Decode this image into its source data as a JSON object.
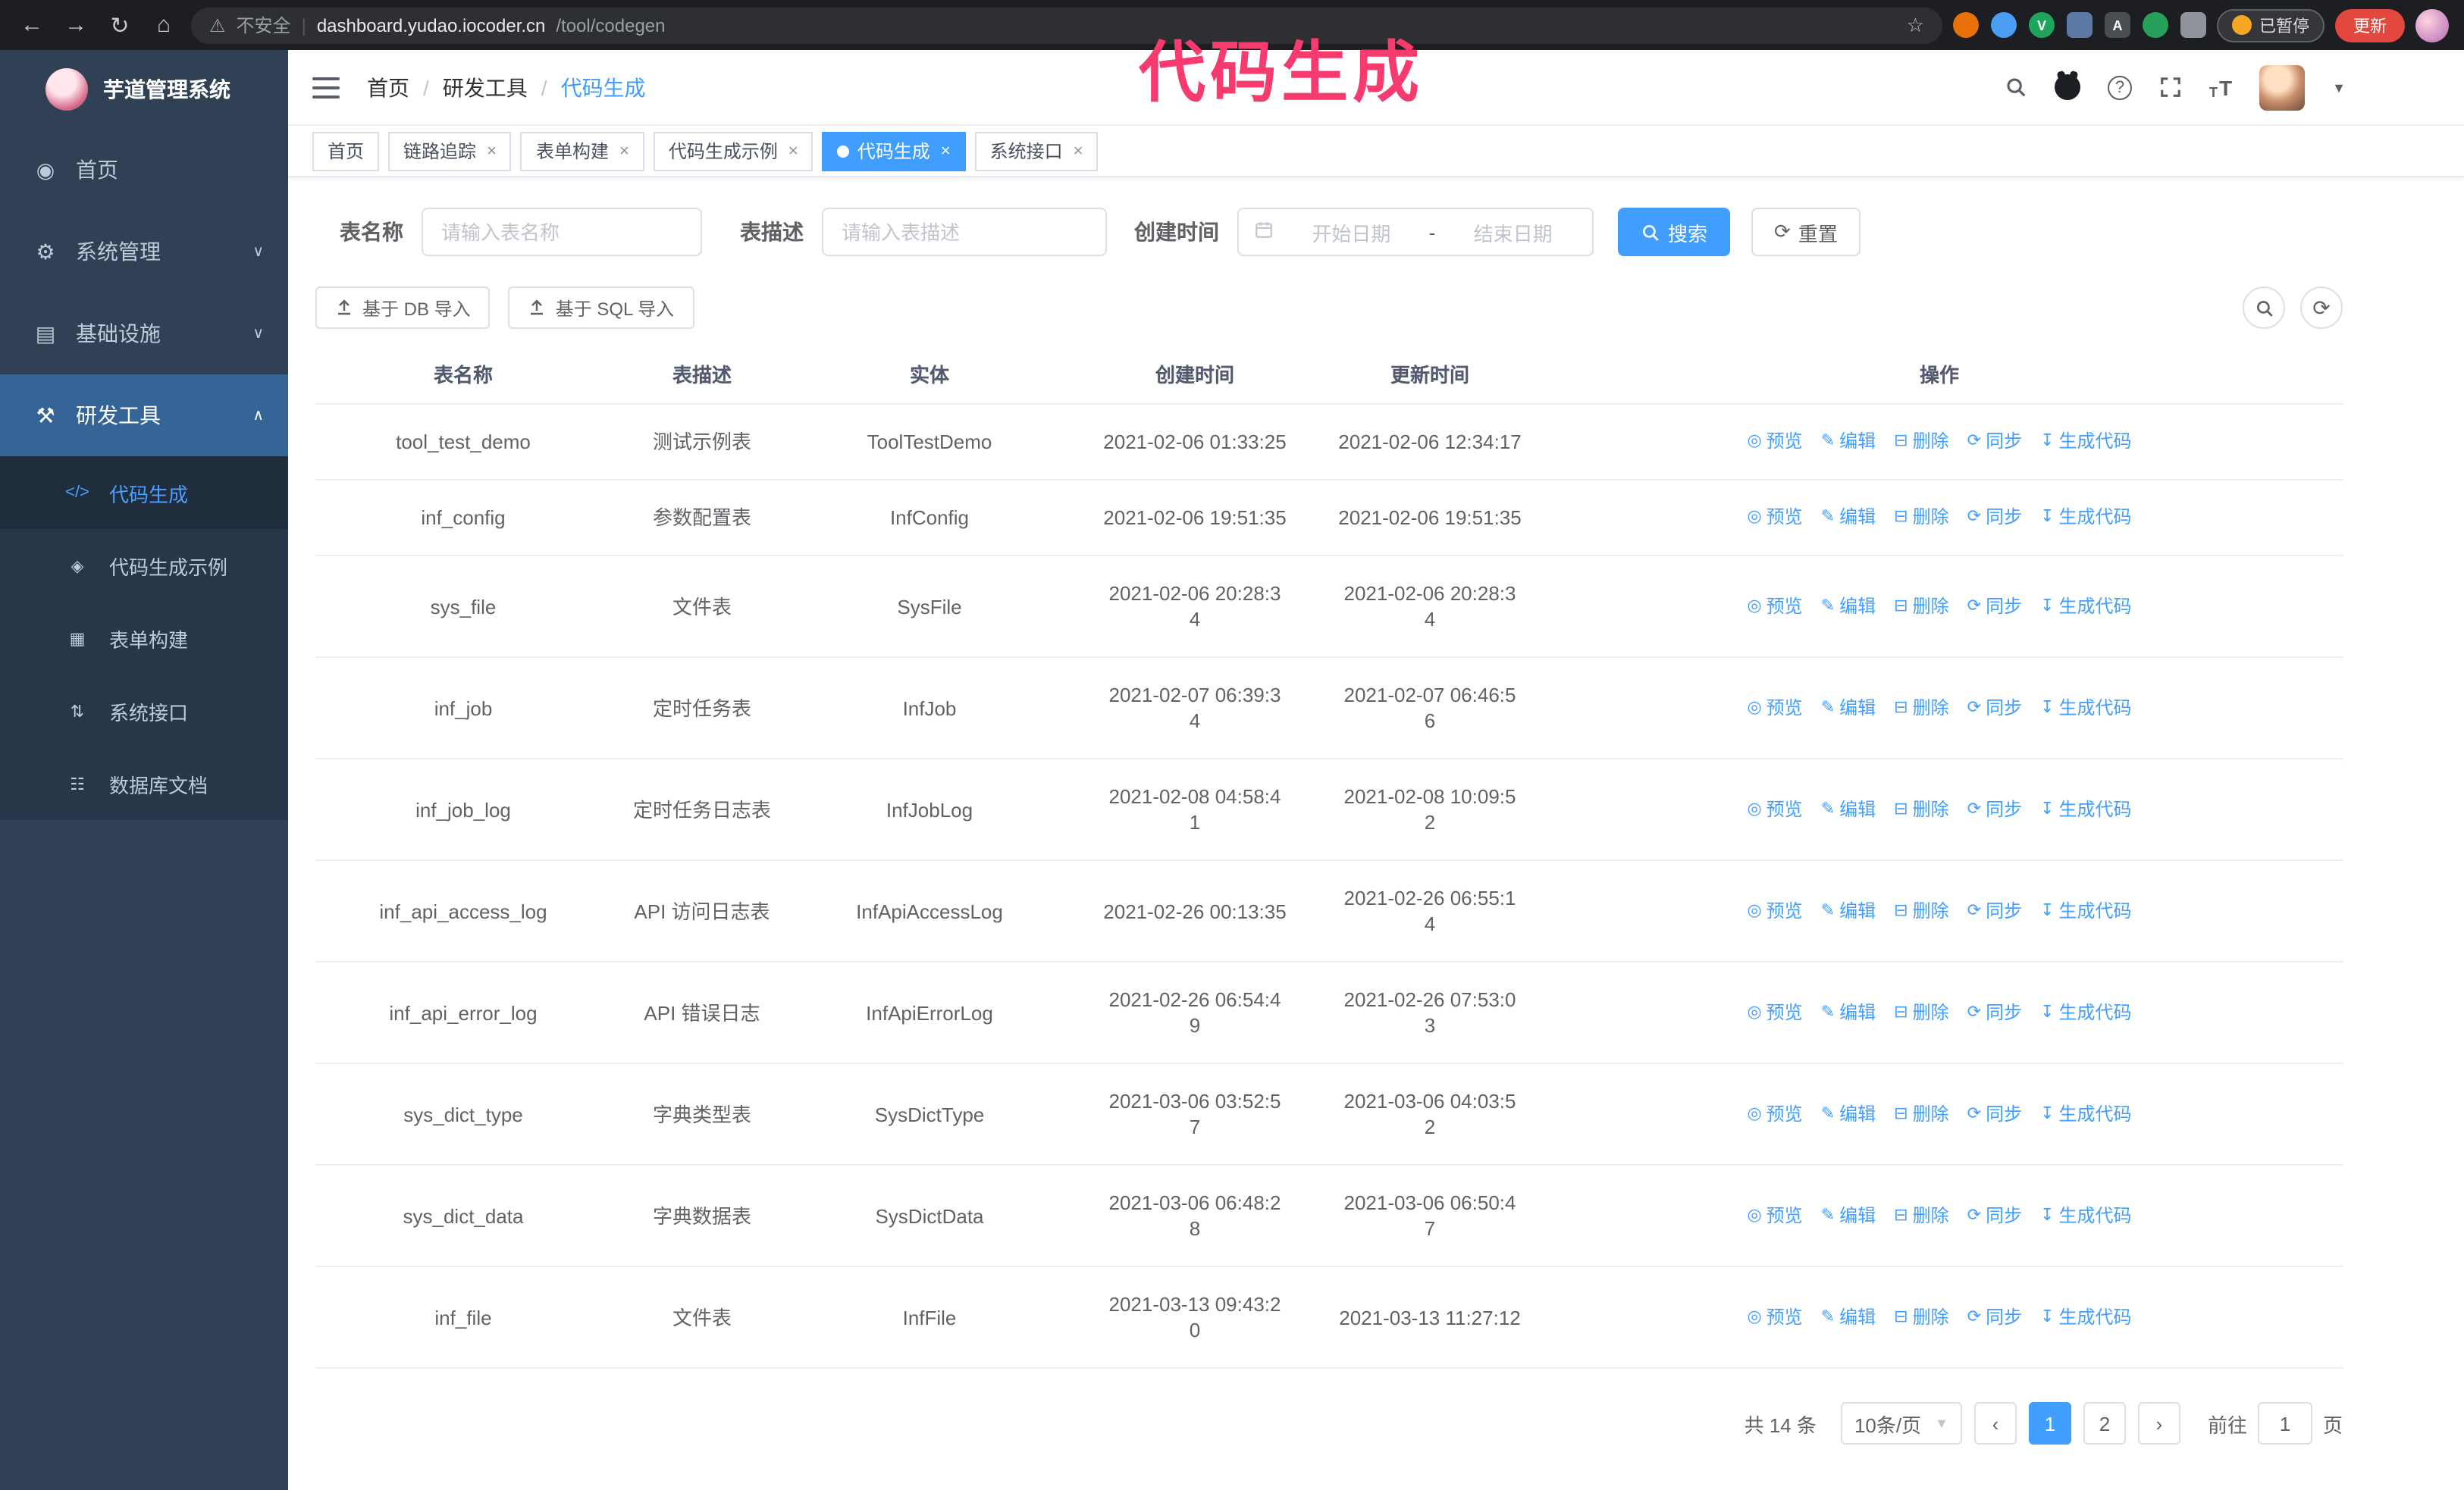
{
  "browser": {
    "warning": "不安全",
    "url_host": "dashboard.yudao.iocoder.cn",
    "url_path": "/tool/codegen",
    "paused_badge": "已暂停",
    "update_button": "更新",
    "extensions": [
      {
        "name": "ext-orange",
        "color": "#e8710a",
        "glyph": "",
        "round": true
      },
      {
        "name": "ext-blue",
        "color": "#4a9ff5",
        "glyph": "",
        "round": true
      },
      {
        "name": "ext-green-v",
        "color": "#1ea55b",
        "glyph": "V",
        "round": true
      },
      {
        "name": "ext-slate",
        "color": "#5b7ba6",
        "glyph": "",
        "round": false
      },
      {
        "name": "ext-dark",
        "color": "#4a4d52",
        "glyph": "A",
        "round": false
      },
      {
        "name": "ext-leaf",
        "color": "#27a05c",
        "glyph": "",
        "round": true
      },
      {
        "name": "ext-puzzle",
        "color": "#8f939a",
        "glyph": "",
        "round": false
      }
    ]
  },
  "annotation": "代码生成",
  "colors": {
    "accent": "#409eff",
    "sidebar": "#304156",
    "annotation": "#f73b6e",
    "update_button": "#e2483d"
  },
  "sidebar": {
    "logo_title": "芋道管理系统",
    "items": [
      {
        "id": "home",
        "label": "首页",
        "icon": "dashboard"
      },
      {
        "id": "system",
        "label": "系统管理",
        "icon": "gear",
        "chevron": "down"
      },
      {
        "id": "infra",
        "label": "基础设施",
        "icon": "monitor",
        "chevron": "down"
      },
      {
        "id": "devtools",
        "label": "研发工具",
        "icon": "tools",
        "chevron": "up",
        "active": true
      }
    ],
    "subitems": [
      {
        "id": "codegen",
        "label": "代码生成",
        "icon": "code",
        "active": true
      },
      {
        "id": "codegen-sample",
        "label": "代码生成示例",
        "icon": "sample"
      },
      {
        "id": "form-build",
        "label": "表单构建",
        "icon": "form"
      },
      {
        "id": "system-api",
        "label": "系统接口",
        "icon": "api"
      },
      {
        "id": "db-doc",
        "label": "数据库文档",
        "icon": "db"
      }
    ]
  },
  "header": {
    "breadcrumb": [
      "首页",
      "研发工具",
      "代码生成"
    ]
  },
  "tags": [
    {
      "label": "首页",
      "closable": false,
      "active": false
    },
    {
      "label": "链路追踪",
      "closable": true,
      "active": false
    },
    {
      "label": "表单构建",
      "closable": true,
      "active": false
    },
    {
      "label": "代码生成示例",
      "closable": true,
      "active": false
    },
    {
      "label": "代码生成",
      "closable": true,
      "active": true
    },
    {
      "label": "系统接口",
      "closable": true,
      "active": false
    }
  ],
  "filters": {
    "table_name_label": "表名称",
    "table_name_placeholder": "请输入表名称",
    "table_desc_label": "表描述",
    "table_desc_placeholder": "请输入表描述",
    "create_time_label": "创建时间",
    "date_start_placeholder": "开始日期",
    "date_separator": "-",
    "date_end_placeholder": "结束日期",
    "search_button": "搜索",
    "reset_button": "重置"
  },
  "toolbar": {
    "import_db": "基于 DB 导入",
    "import_sql": "基于 SQL 导入"
  },
  "table": {
    "columns": [
      "表名称",
      "表描述",
      "实体",
      "创建时间",
      "更新时间",
      "操作"
    ],
    "actions": [
      {
        "id": "preview",
        "label": "预览",
        "icon": "eye"
      },
      {
        "id": "edit",
        "label": "编辑",
        "icon": "edit"
      },
      {
        "id": "delete",
        "label": "删除",
        "icon": "trash"
      },
      {
        "id": "sync",
        "label": "同步",
        "icon": "sync"
      },
      {
        "id": "generate",
        "label": "生成代码",
        "icon": "download"
      }
    ],
    "rows": [
      {
        "name": "tool_test_demo",
        "desc": "测试示例表",
        "entity": "ToolTestDemo",
        "created": "2021-02-06 01:33:25",
        "updated": "2021-02-06 12:34:17"
      },
      {
        "name": "inf_config",
        "desc": "参数配置表",
        "entity": "InfConfig",
        "created": "2021-02-06 19:51:35",
        "updated": "2021-02-06 19:51:35"
      },
      {
        "name": "sys_file",
        "desc": "文件表",
        "entity": "SysFile",
        "created": "2021-02-06 20:28:3\n4",
        "updated": "2021-02-06 20:28:3\n4"
      },
      {
        "name": "inf_job",
        "desc": "定时任务表",
        "entity": "InfJob",
        "created": "2021-02-07 06:39:3\n4",
        "updated": "2021-02-07 06:46:5\n6"
      },
      {
        "name": "inf_job_log",
        "desc": "定时任务日志表",
        "entity": "InfJobLog",
        "created": "2021-02-08 04:58:4\n1",
        "updated": "2021-02-08 10:09:5\n2"
      },
      {
        "name": "inf_api_access_log",
        "desc": "API 访问日志表",
        "entity": "InfApiAccessLog",
        "created": "2021-02-26 00:13:35",
        "updated": "2021-02-26 06:55:1\n4"
      },
      {
        "name": "inf_api_error_log",
        "desc": "API 错误日志",
        "entity": "InfApiErrorLog",
        "created": "2021-02-26 06:54:4\n9",
        "updated": "2021-02-26 07:53:0\n3"
      },
      {
        "name": "sys_dict_type",
        "desc": "字典类型表",
        "entity": "SysDictType",
        "created": "2021-03-06 03:52:5\n7",
        "updated": "2021-03-06 04:03:5\n2"
      },
      {
        "name": "sys_dict_data",
        "desc": "字典数据表",
        "entity": "SysDictData",
        "created": "2021-03-06 06:48:2\n8",
        "updated": "2021-03-06 06:50:4\n7"
      },
      {
        "name": "inf_file",
        "desc": "文件表",
        "entity": "InfFile",
        "created": "2021-03-13 09:43:2\n0",
        "updated": "2021-03-13 11:27:12"
      }
    ]
  },
  "pagination": {
    "total": "共 14 条",
    "page_size": "10条/页",
    "pages": [
      "1",
      "2"
    ],
    "current": "1",
    "goto_label": "前往",
    "goto_value": "1",
    "goto_suffix": "页"
  }
}
